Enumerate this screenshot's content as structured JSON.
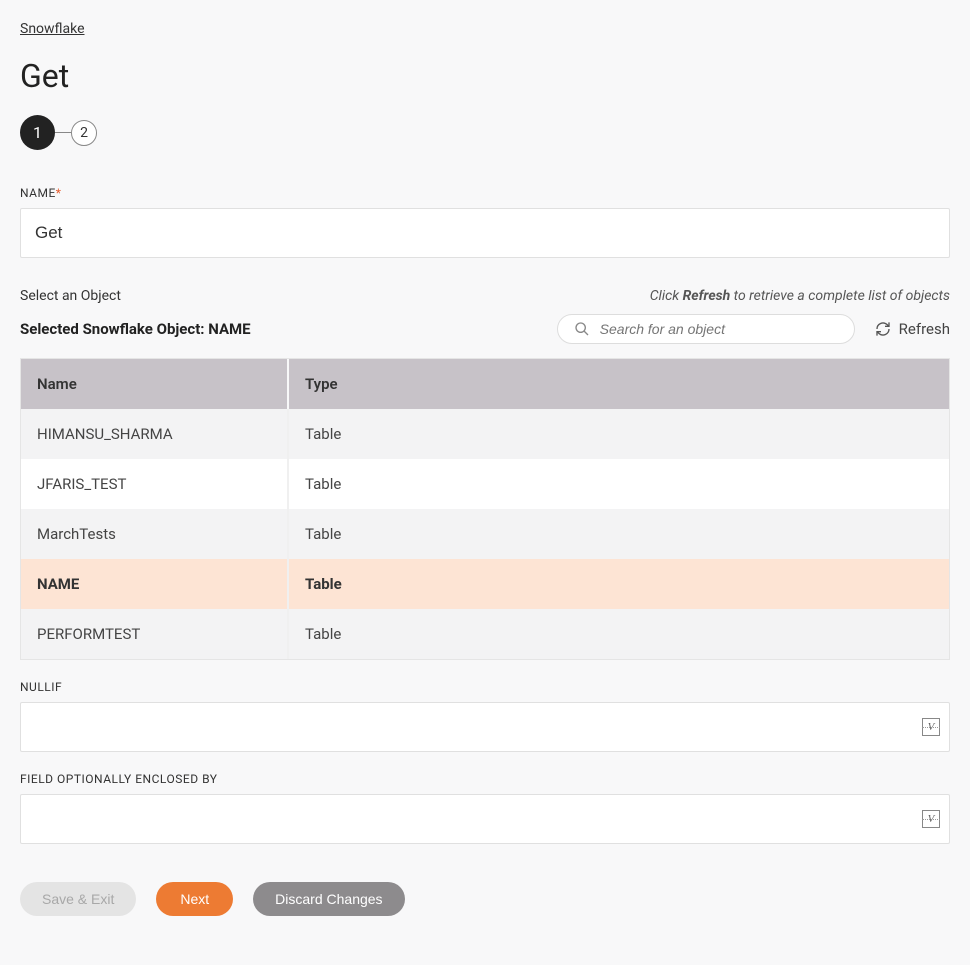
{
  "breadcrumb": "Snowflake",
  "page_title": "Get",
  "stepper": {
    "step1": "1",
    "step2": "2"
  },
  "name_field": {
    "label": "NAME",
    "value": "Get"
  },
  "object_section": {
    "select_label": "Select an Object",
    "hint_prefix": "Click ",
    "hint_bold": "Refresh",
    "hint_suffix": " to retrieve a complete list of objects",
    "selected_label_prefix": "Selected Snowflake Object: ",
    "selected_value": "NAME",
    "search_placeholder": "Search for an object",
    "refresh_label": "Refresh"
  },
  "table": {
    "col_name": "Name",
    "col_type": "Type",
    "rows": [
      {
        "name": "HIMANSU_SHARMA",
        "type": "Table",
        "selected": false
      },
      {
        "name": "JFARIS_TEST",
        "type": "Table",
        "selected": false
      },
      {
        "name": "MarchTests",
        "type": "Table",
        "selected": false
      },
      {
        "name": "NAME",
        "type": "Table",
        "selected": true
      },
      {
        "name": "PERFORMTEST",
        "type": "Table",
        "selected": false
      }
    ]
  },
  "nullif": {
    "label": "NULLIF",
    "value": ""
  },
  "enclosed": {
    "label": "FIELD OPTIONALLY ENCLOSED BY",
    "value": ""
  },
  "buttons": {
    "save_exit": "Save & Exit",
    "next": "Next",
    "discard": "Discard Changes"
  }
}
